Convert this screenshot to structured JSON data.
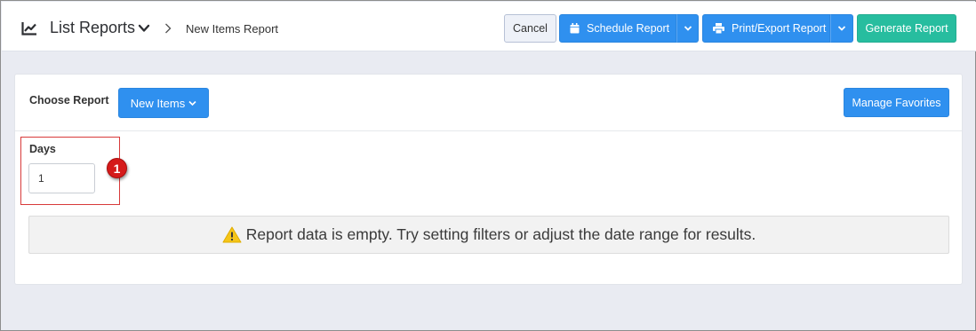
{
  "header": {
    "title": "List Reports",
    "breadcrumb": "New Items Report",
    "buttons": {
      "cancel": "Cancel",
      "schedule": "Schedule Report",
      "print_export": "Print/Export Report",
      "generate": "Generate Report"
    }
  },
  "report_selector": {
    "label": "Choose Report",
    "selected": "New Items",
    "manage_favorites": "Manage Favorites"
  },
  "filters": {
    "days_label": "Days",
    "days_value": "1",
    "marker": "1"
  },
  "alert": {
    "message": "Report data is empty. Try setting filters or adjust the date range for results."
  },
  "colors": {
    "primary": "#2f90ef",
    "success": "#27bd9f",
    "warning": "#f5c518",
    "marker": "#d51a1a"
  },
  "icons": {
    "header": "line-chart-icon",
    "schedule": "calendar-icon",
    "print": "printer-icon",
    "alert": "warning-icon"
  }
}
